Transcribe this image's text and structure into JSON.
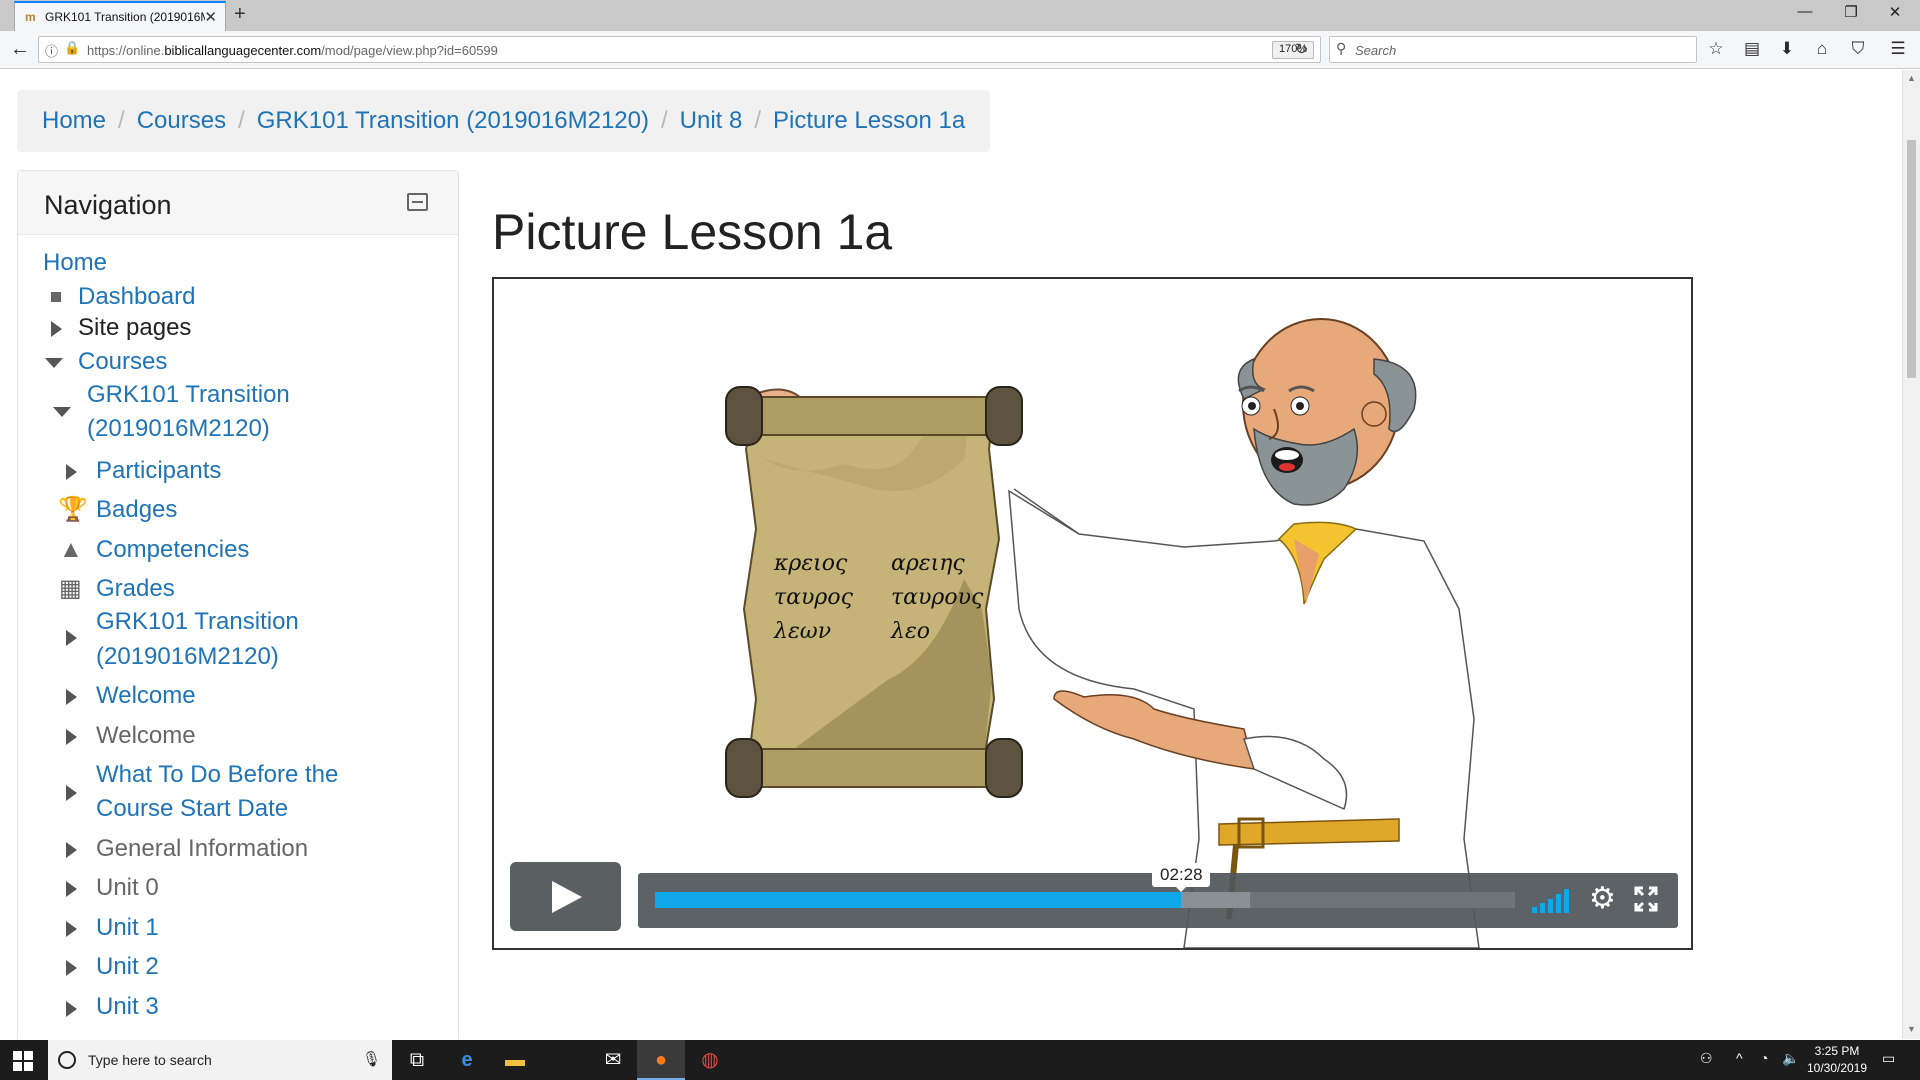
{
  "browser": {
    "tab_title": "GRK101 Transition (2019016M",
    "tab_favicon": "moodle-favicon",
    "url_prefix": "https://online.",
    "url_domain": "biblicallanguagecenter.com",
    "url_path": "/mod/page/view.php?id=60599",
    "zoom": "170%",
    "search_placeholder": "Search"
  },
  "breadcrumb": [
    "Home",
    "Courses",
    "GRK101 Transition (2019016M2120)",
    "Unit 8",
    "Picture Lesson 1a"
  ],
  "navigation": {
    "title": "Navigation",
    "items": [
      {
        "label": "Home",
        "icon": "none",
        "style": "link"
      },
      {
        "label": "Dashboard",
        "icon": "bullet-icon",
        "style": "link"
      },
      {
        "label": "Site pages",
        "icon": "triangle-right-icon",
        "style": "plain"
      },
      {
        "label": "Courses",
        "icon": "triangle-down-icon",
        "style": "link"
      },
      {
        "label": "GRK101 Transition",
        "label2": "(2019016M2120)",
        "icon": "triangle-down-icon",
        "style": "link"
      },
      {
        "label": "Participants",
        "icon": "triangle-right-icon",
        "style": "link"
      },
      {
        "label": "Badges",
        "icon": "trophy-icon",
        "style": "link"
      },
      {
        "label": "Competencies",
        "icon": "competency-icon",
        "style": "link"
      },
      {
        "label": "Grades",
        "icon": "grades-table-icon",
        "style": "link"
      },
      {
        "label": "GRK101 Transition",
        "label2": "(2019016M2120)",
        "icon": "triangle-right-icon",
        "style": "link"
      },
      {
        "label": "Welcome",
        "icon": "triangle-right-icon",
        "style": "link"
      },
      {
        "label": "Welcome",
        "icon": "triangle-right-icon",
        "style": "muted"
      },
      {
        "label": "What To Do Before the",
        "label2": "Course Start Date",
        "icon": "triangle-right-icon",
        "style": "link"
      },
      {
        "label": "General Information",
        "icon": "triangle-right-icon",
        "style": "muted"
      },
      {
        "label": "Unit 0",
        "icon": "triangle-right-icon",
        "style": "muted"
      },
      {
        "label": "Unit 1",
        "icon": "triangle-right-icon",
        "style": "link"
      },
      {
        "label": "Unit 2",
        "icon": "triangle-right-icon",
        "style": "link"
      },
      {
        "label": "Unit 3",
        "icon": "triangle-right-icon",
        "style": "link"
      }
    ]
  },
  "page": {
    "title": "Picture Lesson 1a"
  },
  "video": {
    "scroll_words": [
      [
        "κρειος",
        "αρειης"
      ],
      [
        "ταυρος",
        "ταυρους"
      ],
      [
        "λεων",
        "λεο"
      ]
    ],
    "current_time": "02:28",
    "played_fraction": 0.612,
    "buffered_fraction": 0.692,
    "accent_color": "#0ea8e8"
  },
  "taskbar": {
    "search_placeholder": "Type here to search",
    "time": "3:25 PM",
    "date": "10/30/2019"
  },
  "colors": {
    "link": "#1f73b7",
    "browser_accent": "#0a84ff"
  }
}
